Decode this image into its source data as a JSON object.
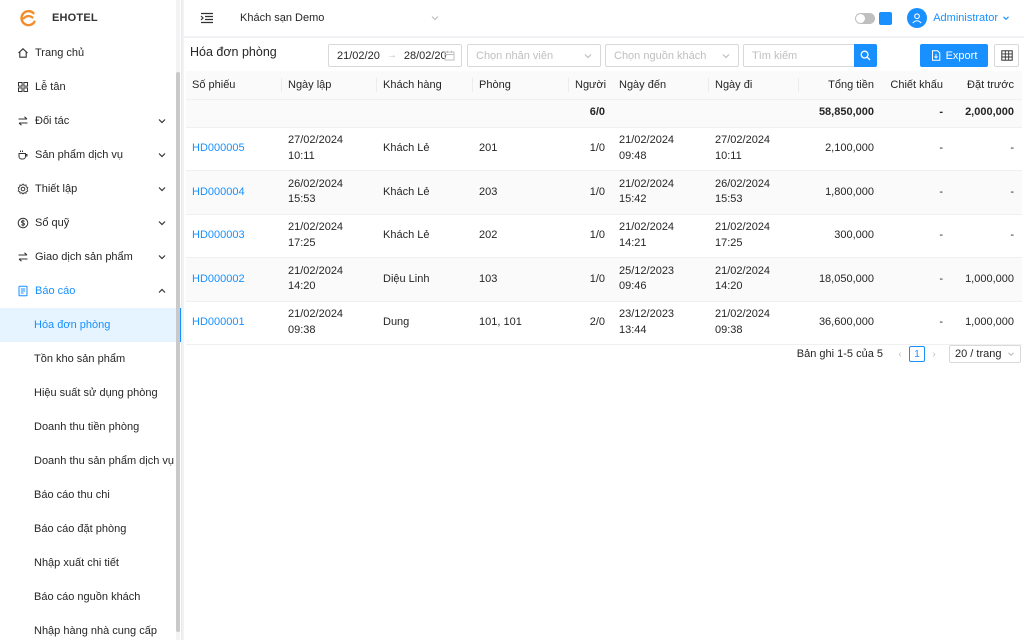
{
  "brand": {
    "name": "EHOTEL",
    "accent": "#f28c28",
    "primary": "#1890ff"
  },
  "sidebar": {
    "items": [
      {
        "label": "Trang chủ",
        "icon": "home-icon",
        "has_children": false
      },
      {
        "label": "Lễ tân",
        "icon": "grid-icon",
        "has_children": false
      },
      {
        "label": "Đối tác",
        "icon": "swap-icon",
        "has_children": true
      },
      {
        "label": "Sản phẩm dịch vụ",
        "icon": "cup-icon",
        "has_children": true
      },
      {
        "label": "Thiết lập",
        "icon": "gear-icon",
        "has_children": true
      },
      {
        "label": "Sổ quỹ",
        "icon": "dollar-icon",
        "has_children": true
      },
      {
        "label": "Giao dịch sản phẩm",
        "icon": "swap-icon",
        "has_children": true
      },
      {
        "label": "Báo cáo",
        "icon": "report-icon",
        "has_children": true,
        "open": true
      }
    ],
    "report_children": [
      "Hóa đơn phòng",
      "Tồn kho sản phẩm",
      "Hiệu suất sử dụng phòng",
      "Doanh thu tiền phòng",
      "Doanh thu sản phẩm dịch vụ",
      "Báo cáo thu chi",
      "Báo cáo đặt phòng",
      "Nhập xuất chi tiết",
      "Báo cáo nguồn khách",
      "Nhập hàng nhà cung cấp"
    ],
    "active_child": "Hóa đơn phòng"
  },
  "header": {
    "hotel": "Khách sạn Demo",
    "user": "Administrator"
  },
  "toolbar": {
    "title": "Hóa đơn phòng",
    "date_from": "21/02/20",
    "date_to": "28/02/20",
    "staff_placeholder": "Chọn nhân viên",
    "source_placeholder": "Chọn nguồn khách",
    "search_placeholder": "Tìm kiếm",
    "export_label": "Export"
  },
  "table": {
    "columns": [
      "Số phiếu",
      "Ngày lập",
      "Khách hàng",
      "Phòng",
      "Người",
      "Ngày đến",
      "Ngày đi",
      "Tổng tiền",
      "Chiết khấu",
      "Đặt trước"
    ],
    "summary": {
      "people": "6/0",
      "total": "58,850,000",
      "discount": "-",
      "deposit": "2,000,000"
    },
    "rows": [
      {
        "code": "HD000005",
        "created_date": "27/02/2024",
        "created_time": "10:11",
        "customer": "Khách Lẻ",
        "room": "201",
        "people": "1/0",
        "arrive_date": "21/02/2024",
        "arrive_time": "09:48",
        "leave_date": "27/02/2024",
        "leave_time": "10:11",
        "total": "2,100,000",
        "discount": "-",
        "deposit": "-"
      },
      {
        "code": "HD000004",
        "created_date": "26/02/2024",
        "created_time": "15:53",
        "customer": "Khách Lẻ",
        "room": "203",
        "people": "1/0",
        "arrive_date": "21/02/2024",
        "arrive_time": "15:42",
        "leave_date": "26/02/2024",
        "leave_time": "15:53",
        "total": "1,800,000",
        "discount": "-",
        "deposit": "-"
      },
      {
        "code": "HD000003",
        "created_date": "21/02/2024",
        "created_time": "17:25",
        "customer": "Khách Lẻ",
        "room": "202",
        "people": "1/0",
        "arrive_date": "21/02/2024",
        "arrive_time": "14:21",
        "leave_date": "21/02/2024",
        "leave_time": "17:25",
        "total": "300,000",
        "discount": "-",
        "deposit": "-"
      },
      {
        "code": "HD000002",
        "created_date": "21/02/2024",
        "created_time": "14:20",
        "customer": "Diệu Linh",
        "room": "103",
        "people": "1/0",
        "arrive_date": "25/12/2023",
        "arrive_time": "09:46",
        "leave_date": "21/02/2024",
        "leave_time": "14:20",
        "total": "18,050,000",
        "discount": "-",
        "deposit": "1,000,000"
      },
      {
        "code": "HD000001",
        "created_date": "21/02/2024",
        "created_time": "09:38",
        "customer": "Dung",
        "room": "101, 101",
        "people": "2/0",
        "arrive_date": "23/12/2023",
        "arrive_time": "13:44",
        "leave_date": "21/02/2024",
        "leave_time": "09:38",
        "total": "36,600,000",
        "discount": "-",
        "deposit": "1,000,000"
      }
    ]
  },
  "pagination": {
    "summary": "Bản ghi 1-5 của 5",
    "current_page": "1",
    "page_size": "20 / trang"
  }
}
